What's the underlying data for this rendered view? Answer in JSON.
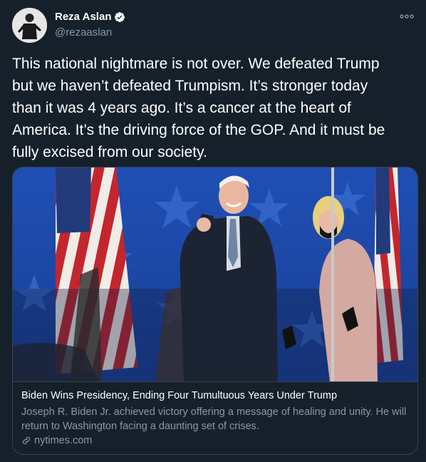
{
  "user": {
    "name": "Reza Aslan",
    "handle": "@rezaaslan"
  },
  "tweet": {
    "text": "This national nightmare is not over. We defeated Trump\nbut we haven’t defeated Trumpism. It’s stronger today\nthan it was 4 years ago. It’s a cancer at the heart of\nAmerica. It’s the driving force of the GOP. And it must be\nfully excised from our society."
  },
  "card": {
    "title": "Biden Wins Presidency, Ending Four Tumultuous Years Under Trump",
    "description": "Joseph R. Biden Jr. achieved victory offering a message of healing and unity. He will return to Washington facing a daunting set of crises.",
    "domain": "nytimes.com"
  },
  "colors": {
    "background": "#15202b",
    "secondary_text": "#8899a6",
    "border": "#38444d",
    "verified": "#1da1f2"
  },
  "icons": [
    "verified-badge-icon",
    "more-options-icon",
    "link-icon"
  ]
}
